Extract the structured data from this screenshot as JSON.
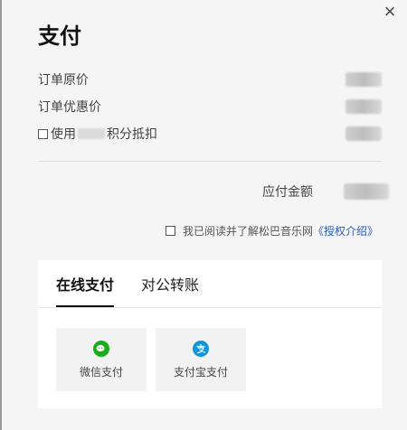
{
  "dialog": {
    "title": "支付",
    "close_icon": "×"
  },
  "summary": {
    "original_price_label": "订单原价",
    "discount_price_label": "订单优惠价",
    "points_prefix": "使用",
    "points_suffix": "积分抵扣",
    "amount_due_label": "应付金额"
  },
  "agreement": {
    "text": "我已阅读并了解松巴音乐网",
    "link": "《授权介绍》"
  },
  "payment": {
    "tabs": [
      {
        "label": "在线支付",
        "active": true
      },
      {
        "label": "对公转账",
        "active": false
      }
    ],
    "methods": [
      {
        "label": "微信支付",
        "icon": "wechat-icon",
        "color": "#1aad19"
      },
      {
        "label": "支付宝支付",
        "icon": "alipay-icon",
        "color": "#1296db"
      }
    ]
  }
}
